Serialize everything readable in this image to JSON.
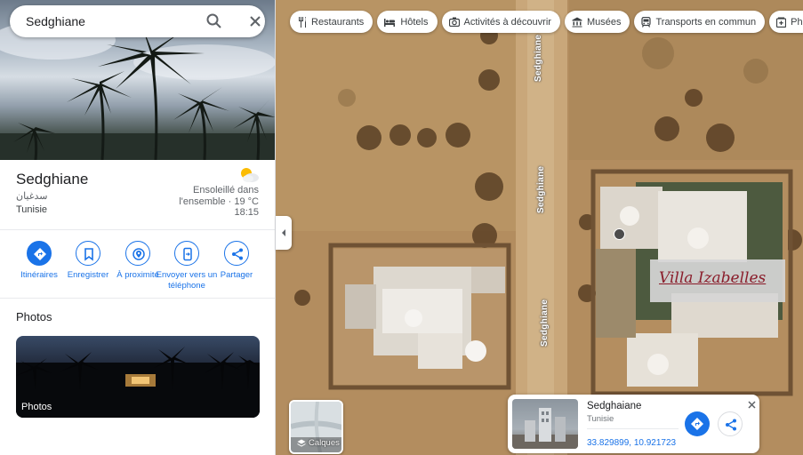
{
  "search": {
    "value": "Sedghiane"
  },
  "place": {
    "name": "Sedghiane",
    "native_name": "سدغيان",
    "country": "Tunisie",
    "weather": {
      "condition": "Ensoleillé dans l'ensemble · 19 °C",
      "time": "18:15",
      "icon": "partly-sunny-icon"
    }
  },
  "actions": [
    {
      "label": "Itinéraires",
      "icon": "directions-icon"
    },
    {
      "label": "Enregistrer",
      "icon": "bookmark-icon"
    },
    {
      "label": "À proximité",
      "icon": "nearby-icon"
    },
    {
      "label": "Envoyer vers un téléphone",
      "icon": "send-to-phone-icon"
    },
    {
      "label": "Partager",
      "icon": "share-icon"
    }
  ],
  "photos": {
    "heading": "Photos",
    "card_label": "Photos"
  },
  "map": {
    "chips": [
      {
        "label": "Restaurants",
        "icon": "restaurant-icon"
      },
      {
        "label": "Hôtels",
        "icon": "hotel-icon"
      },
      {
        "label": "Activités à découvrir",
        "icon": "camera-icon"
      },
      {
        "label": "Musées",
        "icon": "museum-icon"
      },
      {
        "label": "Transports en commun",
        "icon": "transit-icon"
      },
      {
        "label": "Pharm",
        "icon": "pharmacy-icon"
      }
    ],
    "road_labels": [
      "Sedghiane",
      "Sedghiane",
      "Sedghiane"
    ],
    "overlay_label": "Villa Izabelles",
    "layers_label": "Calques"
  },
  "info_card": {
    "name": "Sedghaiane",
    "country": "Tunisie",
    "coords": "33.829899, 10.921723"
  },
  "colors": {
    "accent": "#1a73e8",
    "sand": "#b08c5e",
    "villa_text": "#8a1c2a"
  }
}
